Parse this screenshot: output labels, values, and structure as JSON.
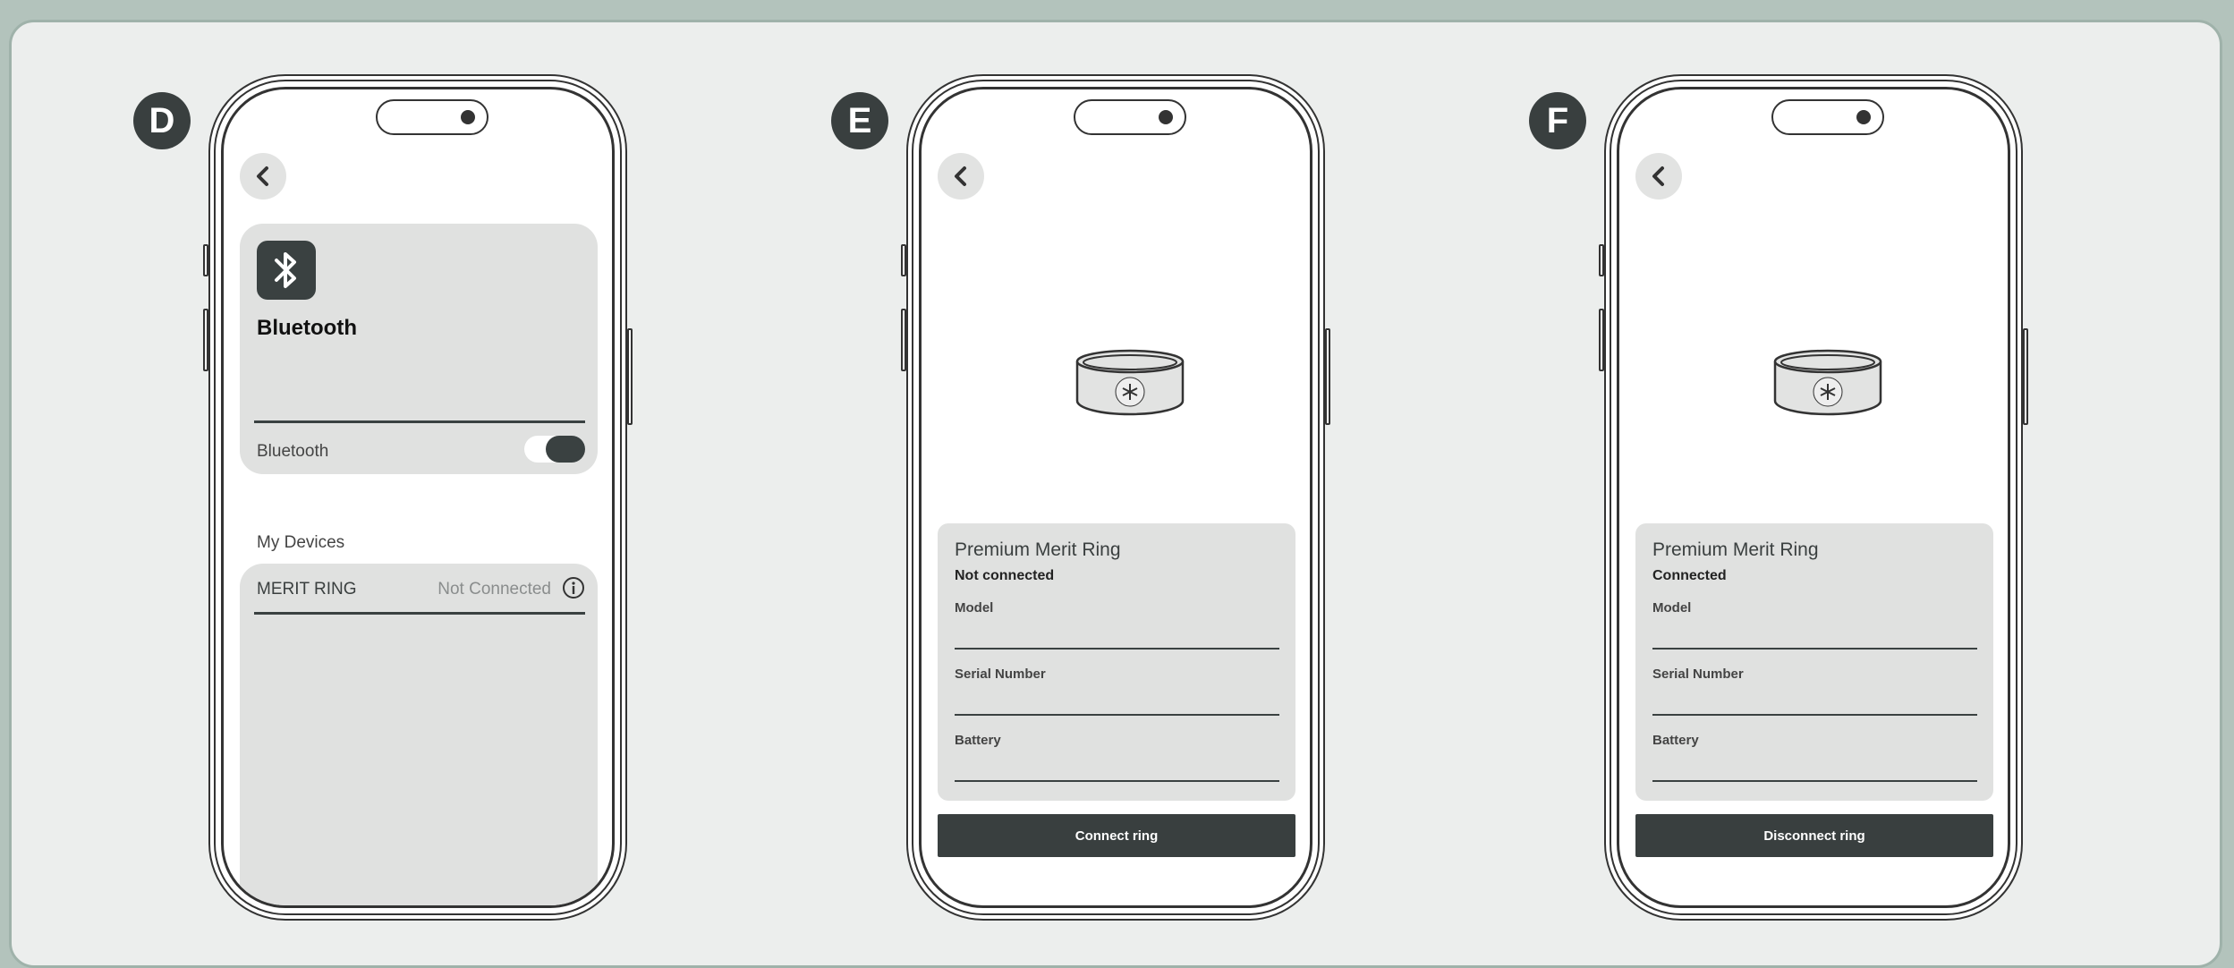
{
  "screens": [
    {
      "badge": "D",
      "bluetooth": {
        "icon": "bluetooth-icon",
        "title": "Bluetooth",
        "toggle_label": "Bluetooth",
        "toggle_on": true
      },
      "my_devices": {
        "heading": "My Devices",
        "device_name": "MERIT RING",
        "device_status": "Not Connected"
      }
    },
    {
      "badge": "E",
      "device_title": "Premium Merit Ring",
      "status": "Not connected",
      "fields": [
        "Model",
        "Serial Number",
        "Battery"
      ],
      "action": "Connect ring"
    },
    {
      "badge": "F",
      "device_title": "Premium Merit Ring",
      "status": "Connected",
      "fields": [
        "Model",
        "Serial Number",
        "Battery"
      ],
      "action": "Disconnect ring"
    }
  ],
  "colors": {
    "accent_dark": "#393f3f",
    "card_bg": "#e0e1e0",
    "panel_bg": "#eceeed",
    "frame_bg": "#b3c3bc"
  }
}
